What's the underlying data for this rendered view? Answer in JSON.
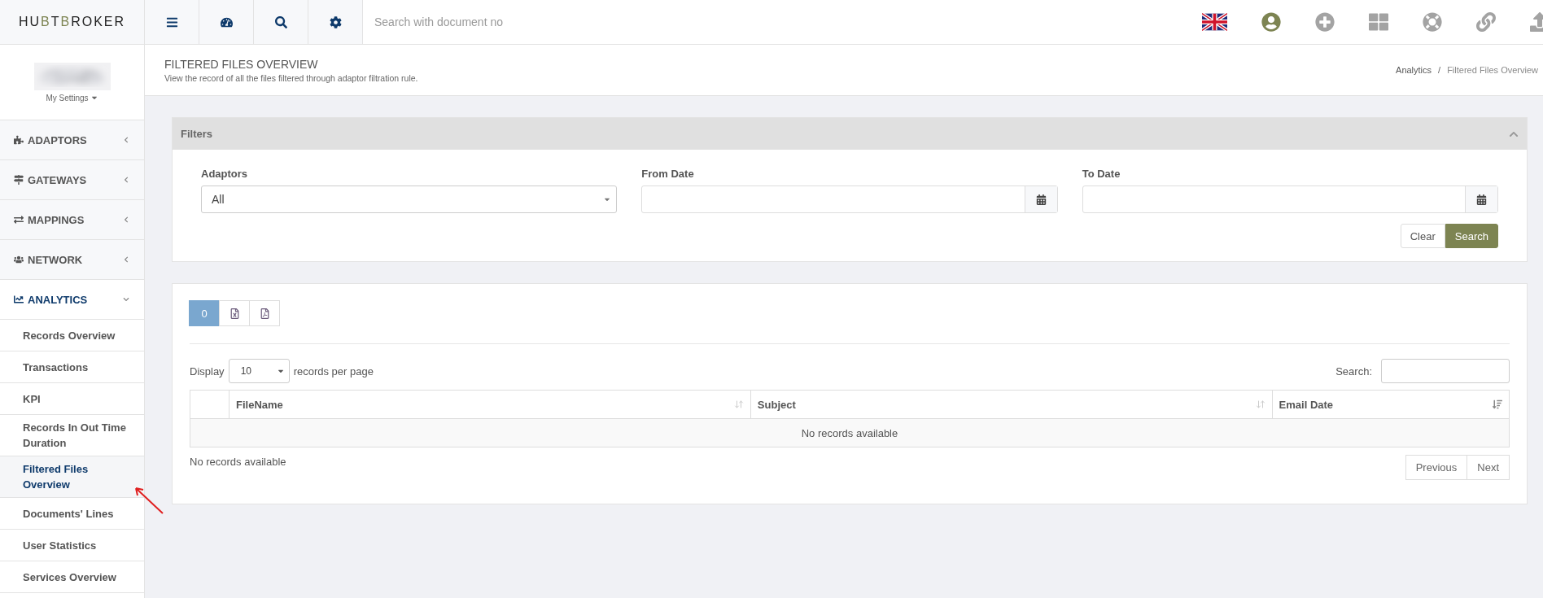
{
  "logo": {
    "parts": [
      {
        "text": "HU",
        "accent": false
      },
      {
        "text": "B",
        "accent": true
      },
      {
        "text": "T",
        "accent": false
      },
      {
        "text": "B",
        "accent": true
      },
      {
        "text": "ROKER",
        "accent": false
      }
    ]
  },
  "toolbar": [
    {
      "kind": "menu"
    },
    {
      "kind": "dashboard"
    },
    {
      "kind": "search"
    },
    {
      "kind": "settings"
    }
  ],
  "global_search": {
    "placeholder": "Search with document no"
  },
  "top_icons": [
    {
      "kind": "flag"
    },
    {
      "kind": "user"
    },
    {
      "kind": "add"
    },
    {
      "kind": "grid"
    },
    {
      "kind": "help"
    },
    {
      "kind": "link"
    },
    {
      "kind": "upload"
    }
  ],
  "profile": {
    "settings_label": "My Settings"
  },
  "sidebar": {
    "items": [
      {
        "label": "ADAPTORS",
        "kind": "adaptors",
        "expanded": false
      },
      {
        "label": "GATEWAYS",
        "kind": "gateways",
        "expanded": false
      },
      {
        "label": "MAPPINGS",
        "kind": "mappings",
        "expanded": false
      },
      {
        "label": "NETWORK",
        "kind": "network",
        "expanded": false
      },
      {
        "label": "ANALYTICS",
        "kind": "analytics",
        "expanded": true,
        "children": [
          {
            "label": "Records Overview",
            "selected": false
          },
          {
            "label": "Transactions",
            "selected": false
          },
          {
            "label": "KPI",
            "selected": false
          },
          {
            "label": "Records In Out Time Duration",
            "selected": false
          },
          {
            "label": "Filtered Files Overview",
            "selected": true
          },
          {
            "label": "Documents' Lines",
            "selected": false
          },
          {
            "label": "User Statistics",
            "selected": false
          },
          {
            "label": "Services Overview",
            "selected": false
          }
        ]
      }
    ]
  },
  "page_header": {
    "title": "FILTERED FILES OVERVIEW",
    "subtitle": "View the record of all the files filtered through adaptor filtration rule.",
    "breadcrumb": [
      "Analytics",
      "Filtered Files Overview"
    ],
    "breadcrumb_separator": "/"
  },
  "filters": {
    "title": "Filters",
    "expanded": true,
    "fields": [
      {
        "label": "Adaptors",
        "kind": "select",
        "value": "All"
      },
      {
        "label": "From Date",
        "kind": "date"
      },
      {
        "label": "To Date",
        "kind": "date"
      }
    ],
    "buttons": [
      {
        "label": "Clear",
        "kind": "default"
      },
      {
        "label": "Search",
        "kind": "primary"
      }
    ]
  },
  "results": {
    "export_buttons": [
      {
        "kind": "count",
        "label": "0"
      },
      {
        "kind": "excel"
      },
      {
        "kind": "pdf"
      }
    ],
    "length": {
      "prefix": "Display",
      "value": "10",
      "suffix": "records per page"
    },
    "search_label": "Search:",
    "table": {
      "columns": [
        {
          "label": "FileName",
          "sorted": false
        },
        {
          "label": "Subject",
          "sorted": false
        },
        {
          "label": "Email Date",
          "sorted": true
        }
      ],
      "empty": "No records available"
    },
    "info": "No records available",
    "pagination": [
      "Previous",
      "Next"
    ]
  },
  "annotation": {
    "kind": "arrow"
  }
}
